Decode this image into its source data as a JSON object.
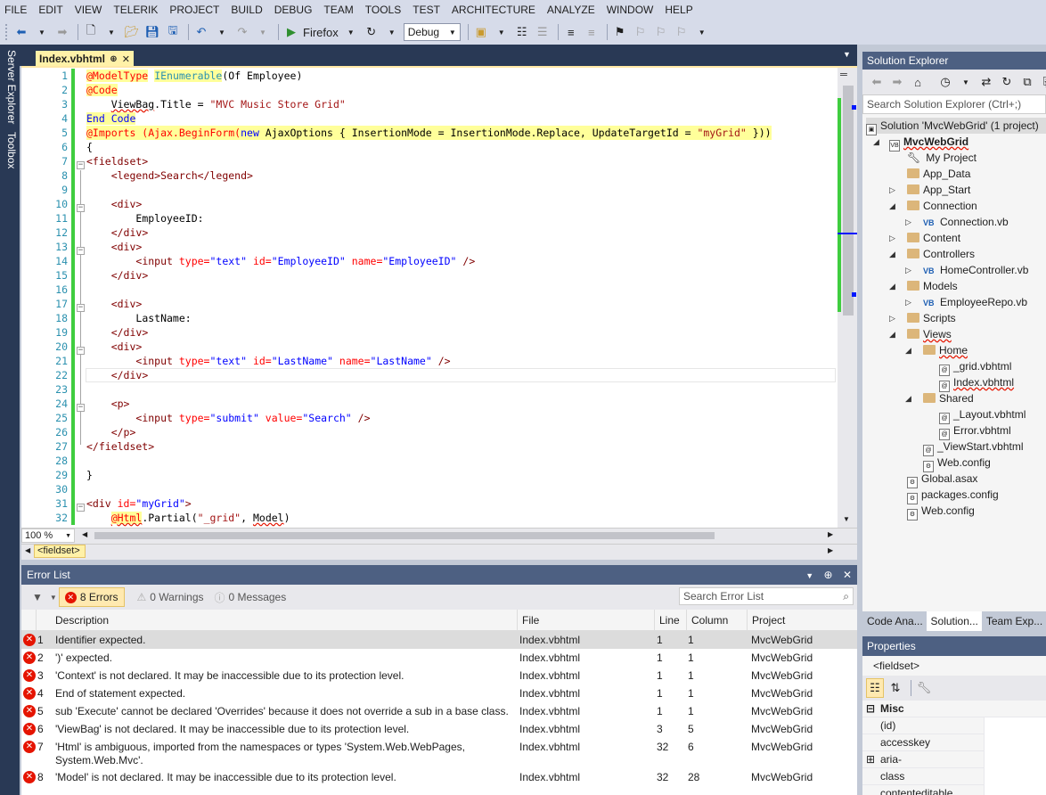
{
  "menu": [
    "FILE",
    "EDIT",
    "VIEW",
    "TELERIK",
    "PROJECT",
    "BUILD",
    "DEBUG",
    "TEAM",
    "TOOLS",
    "TEST",
    "ARCHITECTURE",
    "ANALYZE",
    "WINDOW",
    "HELP"
  ],
  "toolbar": {
    "browser": "Firefox",
    "config": "Debug"
  },
  "side_tabs": {
    "server_explorer": "Server Explorer",
    "toolbox": "Toolbox"
  },
  "editor": {
    "tab_title": "Index.vbhtml",
    "zoom": "100 %",
    "breadcrumb": "<fieldset>",
    "line_numbers": [
      "1",
      "2",
      "3",
      "4",
      "5",
      "6",
      "7",
      "8",
      "9",
      "10",
      "11",
      "12",
      "13",
      "14",
      "15",
      "16",
      "17",
      "18",
      "19",
      "20",
      "21",
      "22",
      "23",
      "24",
      "25",
      "26",
      "27",
      "28",
      "29",
      "30",
      "31",
      "32"
    ],
    "lines": {
      "l1a": "@ModelType",
      "l1b": "IEnumerable",
      "l1c": "(Of Employee)",
      "l2": "@Code",
      "l3a": "ViewBag",
      "l3b": ".Title = ",
      "l3c": "\"MVC Music Store Grid\"",
      "l4": "End Code",
      "l5a": "@Imports (Ajax.BeginForm(",
      "l5b": "new",
      "l5c": " AjaxOptions { InsertionMode = InsertionMode.Replace, UpdateTargetId = ",
      "l5d": "\"myGrid\"",
      "l5e": " }))",
      "l6": "{",
      "l7": "<fieldset>",
      "l8": "<legend>Search</legend>",
      "l10": "<div>",
      "l11": "EmployeeID:",
      "l12": "</div>",
      "l13": "<div>",
      "l14a": "<input",
      "l14b": " type=",
      "l14c": "\"text\"",
      "l14d": " id=",
      "l14e": "\"EmployeeID\"",
      "l14f": " name=",
      "l14g": "\"EmployeeID\"",
      "l14h": " />",
      "l15": "</div>",
      "l17": "<div>",
      "l18": "LastName:",
      "l19": "</div>",
      "l20": "<div>",
      "l21a": "<input",
      "l21b": " type=",
      "l21c": "\"text\"",
      "l21d": " id=",
      "l21e": "\"LastName\"",
      "l21f": " name=",
      "l21g": "\"LastName\"",
      "l21h": " />",
      "l22": "</div>",
      "l24": "<p>",
      "l25a": "<input",
      "l25b": " type=",
      "l25c": "\"submit\"",
      "l25d": " value=",
      "l25e": "\"Search\"",
      "l25f": " />",
      "l26": "</p>",
      "l27": "</fieldset>",
      "l29": "}",
      "l31a": "<div",
      "l31b": " id=",
      "l31c": "\"myGrid\"",
      "l31d": ">",
      "l32a": "@Html",
      "l32b": ".Partial(",
      "l32c": "\"_grid\"",
      "l32d": ", ",
      "l32e": "Model",
      "l32f": ")"
    }
  },
  "error_list": {
    "title": "Error List",
    "errors_filter": "8 Errors",
    "warnings_filter": "0 Warnings",
    "messages_filter": "0 Messages",
    "search_placeholder": "Search Error List",
    "columns": {
      "description": "Description",
      "file": "File",
      "line": "Line",
      "column": "Column",
      "project": "Project"
    },
    "rows": [
      {
        "n": "1",
        "desc": "Identifier expected.",
        "file": "Index.vbhtml",
        "line": "1",
        "col": "1",
        "project": "MvcWebGrid"
      },
      {
        "n": "2",
        "desc": "')' expected.",
        "file": "Index.vbhtml",
        "line": "1",
        "col": "1",
        "project": "MvcWebGrid"
      },
      {
        "n": "3",
        "desc": "'Context' is not declared. It may be inaccessible due to its protection level.",
        "file": "Index.vbhtml",
        "line": "1",
        "col": "1",
        "project": "MvcWebGrid"
      },
      {
        "n": "4",
        "desc": "End of statement expected.",
        "file": "Index.vbhtml",
        "line": "1",
        "col": "1",
        "project": "MvcWebGrid"
      },
      {
        "n": "5",
        "desc": "sub 'Execute' cannot be declared 'Overrides' because it does not override a sub in a base class.",
        "file": "Index.vbhtml",
        "line": "1",
        "col": "1",
        "project": "MvcWebGrid"
      },
      {
        "n": "6",
        "desc": "'ViewBag' is not declared. It may be inaccessible due to its protection level.",
        "file": "Index.vbhtml",
        "line": "3",
        "col": "5",
        "project": "MvcWebGrid"
      },
      {
        "n": "7",
        "desc": "'Html' is ambiguous, imported from the namespaces or types 'System.Web.WebPages,",
        "desc2": "System.Web.Mvc'.",
        "file": "Index.vbhtml",
        "line": "32",
        "col": "6",
        "project": "MvcWebGrid"
      },
      {
        "n": "8",
        "desc": "'Model' is not declared. It may be inaccessible due to its protection level.",
        "file": "Index.vbhtml",
        "line": "32",
        "col": "28",
        "project": "MvcWebGrid"
      }
    ]
  },
  "solution_explorer": {
    "title": "Solution Explorer",
    "search_placeholder": "Search Solution Explorer (Ctrl+;)",
    "items": [
      "Solution 'MvcWebGrid' (1 project)",
      "MvcWebGrid",
      "My Project",
      "App_Data",
      "App_Start",
      "Connection",
      "Connection.vb",
      "Content",
      "Controllers",
      "HomeController.vb",
      "Models",
      "EmployeeRepo.vb",
      "Scripts",
      "Views",
      "Home",
      "_grid.vbhtml",
      "Index.vbhtml",
      "Shared",
      "_Layout.vbhtml",
      "Error.vbhtml",
      "_ViewStart.vbhtml",
      "Web.config",
      "Global.asax",
      "packages.config",
      "Web.config"
    ],
    "tabs": [
      "Code Ana...",
      "Solution...",
      "Team Exp..."
    ]
  },
  "properties": {
    "title": "Properties",
    "object": "<fieldset>",
    "category": "Misc",
    "rows": [
      "(id)",
      "accesskey",
      "aria-",
      "class",
      "contenteditable"
    ]
  }
}
